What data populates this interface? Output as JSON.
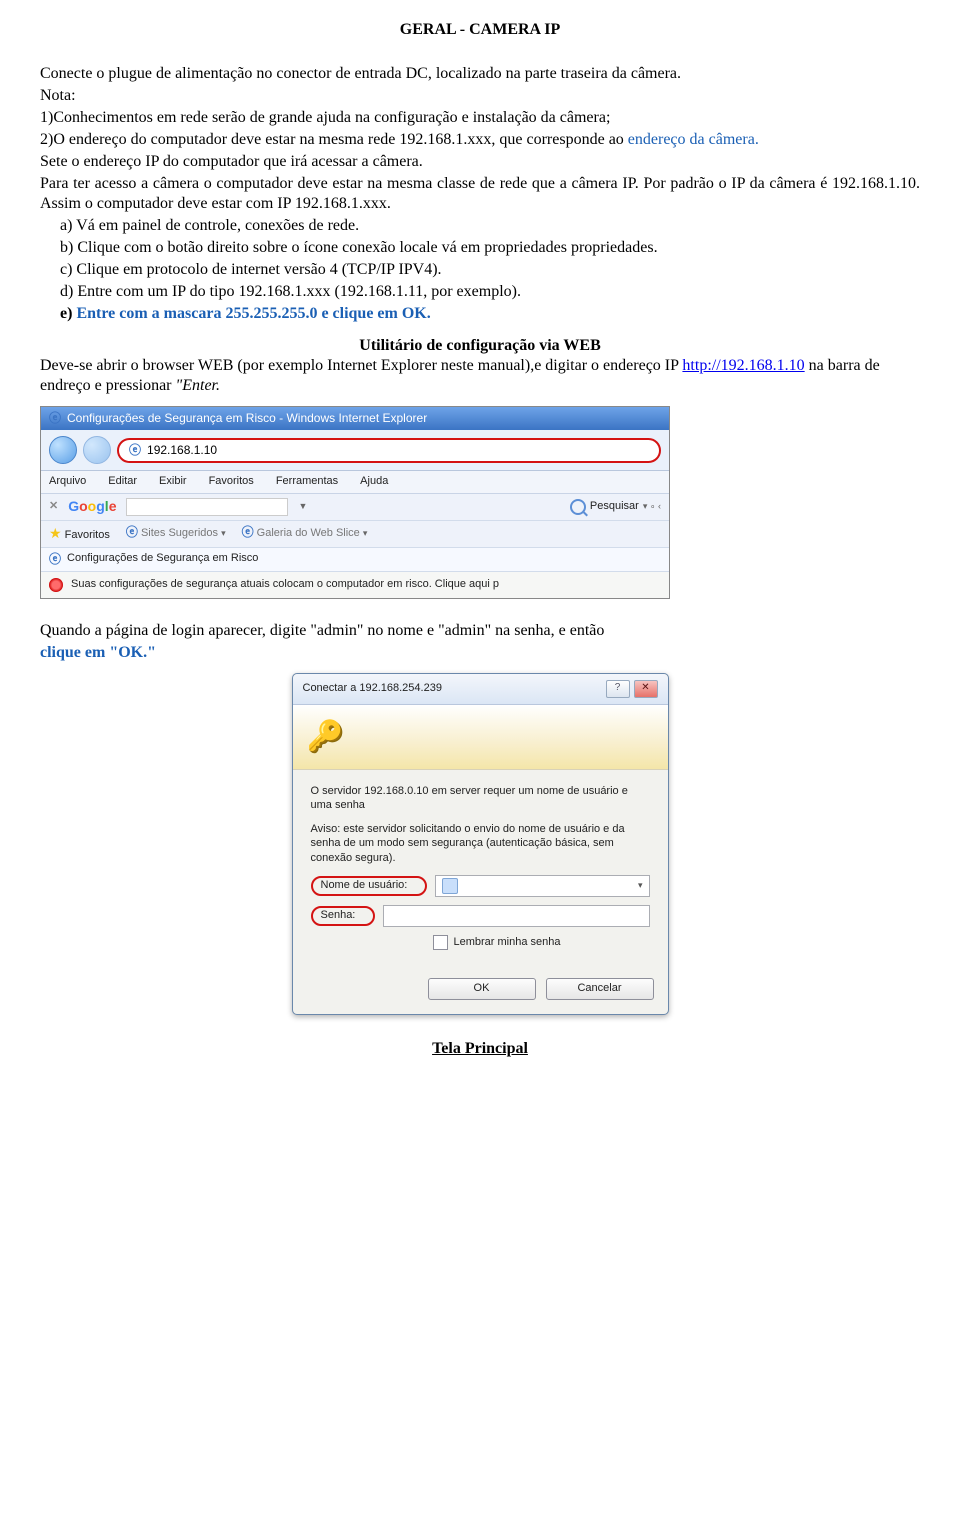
{
  "title": "GERAL - CAMERA IP",
  "intro": "Conecte o plugue de alimentação no conector de entrada DC, localizado na parte traseira da câmera.",
  "nota_label": "Nota:",
  "note1": "1)Conhecimentos em rede serão de grande ajuda na configuração e instalação da câmera;",
  "note2_prefix": "2)O endereço do computador deve estar na mesma rede 192.168.1.xxx, que corresponde ao ",
  "note2_blue": "endereço da câmera.",
  "set_ip": "Sete o endereço IP do computador que irá acessar a câmera.",
  "para_access": "Para ter acesso a câmera o computador deve estar na mesma classe de rede que a câmera IP. Por padrão o IP da câmera é 192.168.1.10. Assim o computador deve estar com IP 192.168.1.xxx.",
  "item_a": "a)   Vá em painel de controle, conexões de rede.",
  "item_b": "b)   Clique com o botão direito sobre o ícone conexão locale vá em propriedades propriedades.",
  "item_c": "c)   Clique em protocolo de internet versão 4 (TCP/IP IPV4).",
  "item_d": "d)   Entre com um IP do tipo 192.168.1.xxx (192.168.1.11, por exemplo).",
  "item_e_label": "e)   ",
  "item_e_blue": "Entre com a mascara 255.255.255.0 e clique em OK.",
  "util_heading": "Utilitário de configuração via WEB",
  "util_line_pre": "Deve-se abrir o browser WEB (por exemplo Internet Explorer neste manual),e digitar o endereço IP ",
  "util_link": "http://192.168.1.10",
  "util_line_post_a": " na barra de endreço e pressionar ",
  "util_enter_italic": "\"Enter.",
  "ie": {
    "title": "Configurações de Segurança em Risco - Windows Internet Explorer",
    "url": "192.168.1.10",
    "menus": [
      "Arquivo",
      "Editar",
      "Exibir",
      "Favoritos",
      "Ferramentas",
      "Ajuda"
    ],
    "google": "Google",
    "pesquisar": "Pesquisar",
    "favoritos": "Favoritos",
    "sites_sug": "Sites Sugeridos",
    "galeria": "Galeria do Web Slice",
    "tab": "Configurações de Segurança em Risco",
    "warn": "Suas configurações de segurança atuais colocam o computador em risco. Clique aqui p"
  },
  "login_intro_a": "Quando a página de login aparecer, digite \"admin\" no nome e \"admin\" na senha, e então",
  "login_intro_b": "clique em \"OK.\"",
  "dlg": {
    "title": "Conectar a 192.168.254.239",
    "body1": "O servidor 192.168.0.10 em server requer um nome de usuário e uma senha",
    "body2": "Aviso: este servidor solicitando o envio do nome de usuário e da senha de um modo sem segurança (autenticação básica, sem conexão segura).",
    "user_label": "Nome de usuário:",
    "pass_label": "Senha:",
    "remember": "Lembrar minha senha",
    "ok": "OK",
    "cancel": "Cancelar"
  },
  "footer": "Tela Principal"
}
